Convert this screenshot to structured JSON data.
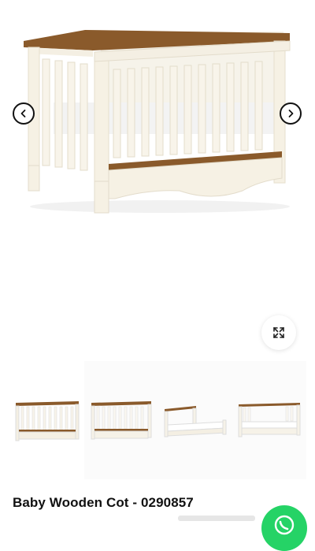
{
  "gallery": {
    "main_image": "cot-main-image",
    "prev_icon": "chevron-left-icon",
    "next_icon": "chevron-right-icon",
    "zoom_icon": "expand-icon"
  },
  "thumbnails": [
    {
      "name": "thumbnail-cot-front"
    },
    {
      "name": "thumbnail-cot-side"
    },
    {
      "name": "thumbnail-toddler-bed"
    },
    {
      "name": "thumbnail-day-bed"
    }
  ],
  "product": {
    "title": "Baby Wooden Cot - 0290857"
  },
  "chat": {
    "icon": "whatsapp-icon",
    "color": "#25d366"
  }
}
